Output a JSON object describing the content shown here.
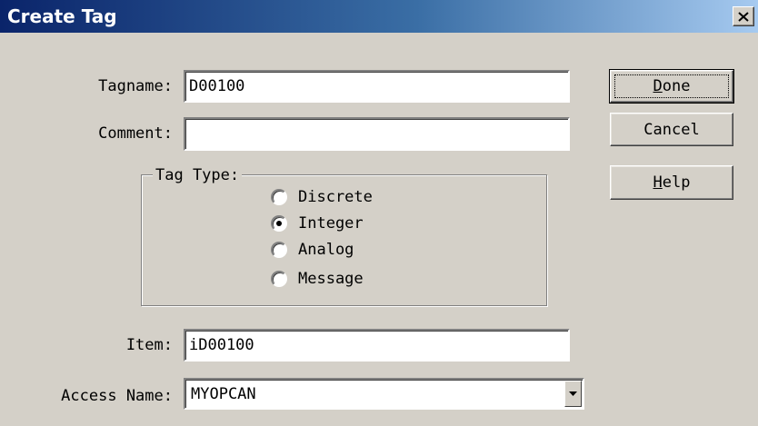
{
  "window": {
    "title": "Create Tag",
    "close_icon": "close-icon"
  },
  "form": {
    "tagname": {
      "label": "Tagname:",
      "value": "D00100"
    },
    "comment": {
      "label": "Comment:",
      "value": ""
    },
    "tag_type": {
      "label": "Tag Type:",
      "options": [
        "Discrete",
        "Integer",
        "Analog",
        "Message"
      ],
      "selected": "Integer"
    },
    "item": {
      "label": "Item:",
      "value": "iD00100"
    },
    "access_name": {
      "label": "Access Name:",
      "value": "MYOPCAN",
      "dropdown_icon": "chevron-down-icon"
    }
  },
  "buttons": {
    "done": {
      "label_underlined": "D",
      "label_rest": "one"
    },
    "cancel": {
      "label": "Cancel"
    },
    "help": {
      "label_underlined": "H",
      "label_rest": "elp"
    }
  }
}
